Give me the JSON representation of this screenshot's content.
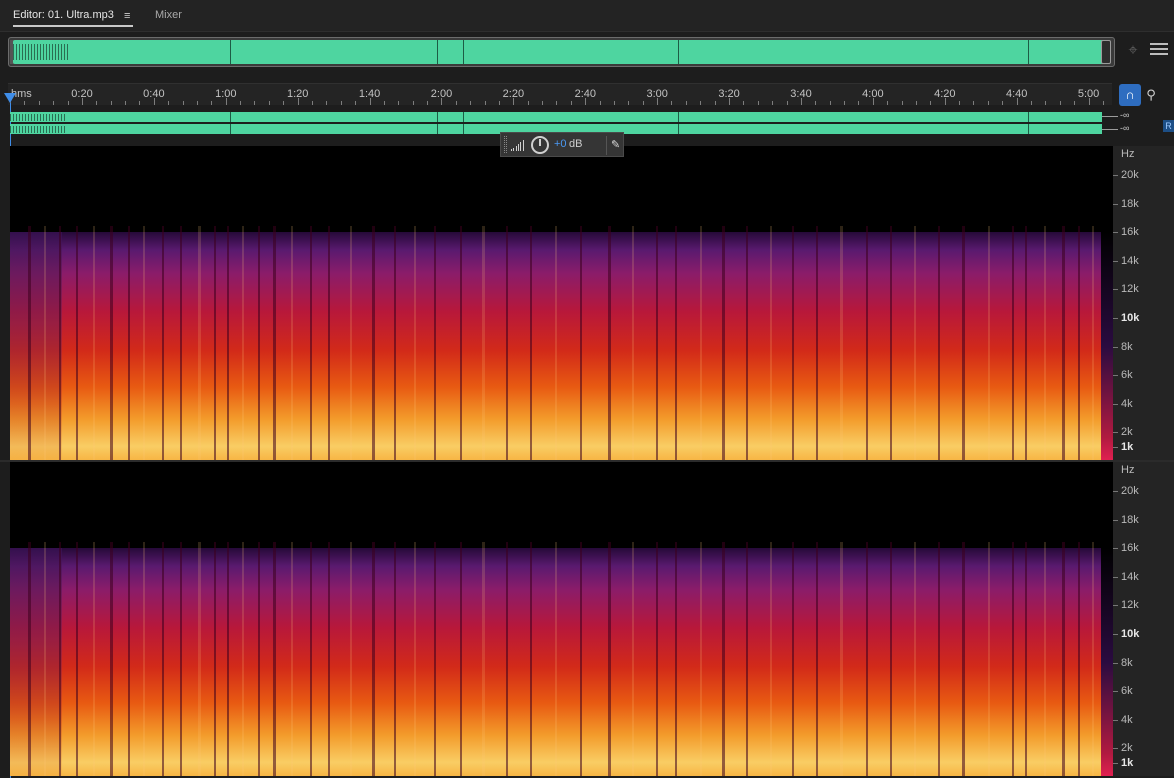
{
  "tabs": {
    "editor_label": "Editor: 01. Ultra.mp3",
    "menu_glyph": "≡",
    "mixer_label": "Mixer"
  },
  "icons": {
    "zoom": "zoom-to-fit-icon",
    "panel_menu": "panel-menu-icon",
    "snap": "magnet-snap-icon",
    "marker": "marker-pin-icon",
    "hud_meter": "level-meter-icon",
    "hud_knob": "volume-knob-icon",
    "hud_pin": "pin-icon"
  },
  "ruler": {
    "unit": "hms",
    "labels": [
      "0:20",
      "0:40",
      "1:00",
      "1:20",
      "1:40",
      "2:00",
      "2:20",
      "2:40",
      "3:00",
      "3:20",
      "3:40",
      "4:00",
      "4:20",
      "4:40",
      "5:00"
    ]
  },
  "lanes": {
    "db_1": "-∞",
    "db_2": "-∞",
    "channel_tag": "R"
  },
  "hud": {
    "value": "+0",
    "unit": "dB"
  },
  "scale_top": {
    "unit": "Hz",
    "labels": [
      "20k",
      "18k",
      "16k",
      "14k",
      "12k",
      "10k",
      "8k",
      "6k",
      "4k",
      "2k",
      "1k"
    ]
  },
  "scale_bottom": {
    "unit": "Hz",
    "labels": [
      "20k",
      "18k",
      "16k",
      "14k",
      "12k",
      "10k",
      "8k",
      "6k",
      "4k",
      "2k",
      "1k"
    ]
  },
  "colors": {
    "waveform": "#4ed5a0",
    "playhead": "#3f8de8",
    "accent": "#2e6dc0"
  }
}
